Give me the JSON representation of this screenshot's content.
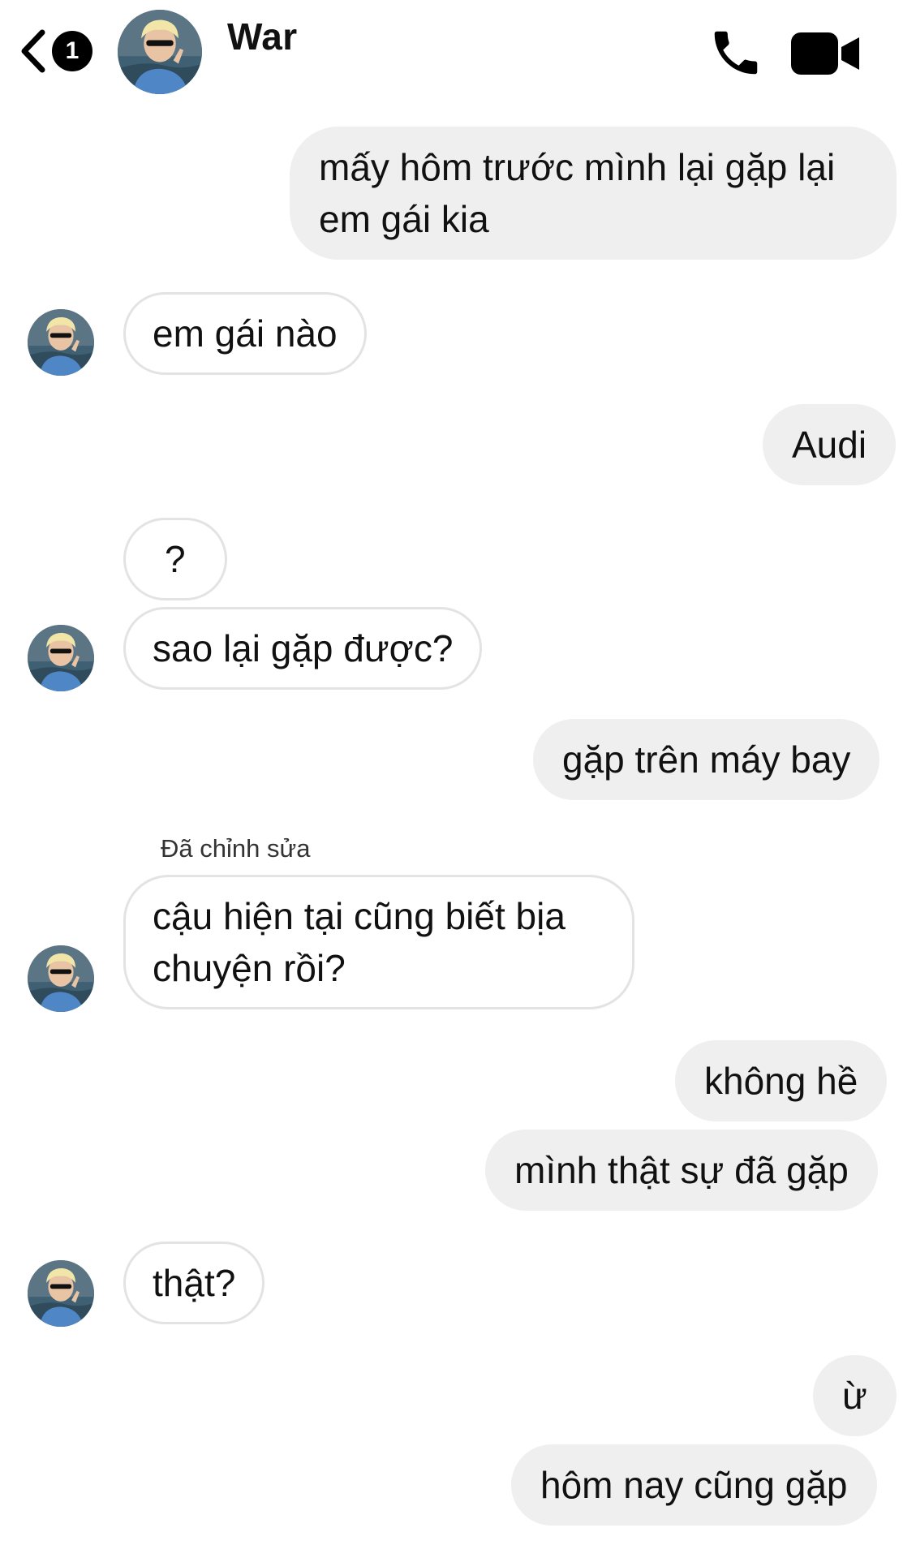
{
  "header": {
    "back_badge": "1",
    "contact_name": "War"
  },
  "messages": [
    {
      "text": "mấy hôm trước mình lại gặp lại em gái kia",
      "line1": "mấy hôm trước mình lại gặp lại",
      "line2": "em gái kia",
      "from": "me"
    },
    {
      "text": "em gái nào",
      "from": "them"
    },
    {
      "text": "Audi",
      "from": "me"
    },
    {
      "text": "?",
      "from": "them"
    },
    {
      "text": "sao lại gặp được?",
      "from": "them"
    },
    {
      "text": "gặp trên máy bay",
      "from": "me"
    },
    {
      "label": "Đã chỉnh sửa",
      "line1": "cậu hiện tại cũng biết bịa",
      "line2": "chuyện rồi?",
      "from": "them"
    },
    {
      "text": "không hề",
      "from": "me"
    },
    {
      "text": "mình thật sự đã gặp",
      "from": "me"
    },
    {
      "text": "thật?",
      "from": "them"
    },
    {
      "text": "ừ",
      "from": "me"
    },
    {
      "text": "hôm nay cũng gặp",
      "from": "me"
    }
  ],
  "colors": {
    "outgoing_bubble": "#efefef",
    "incoming_border": "#e3e3e3",
    "icons": "#000000"
  },
  "icons": [
    "chevron-left-icon",
    "phone-icon",
    "video-camera-icon"
  ]
}
